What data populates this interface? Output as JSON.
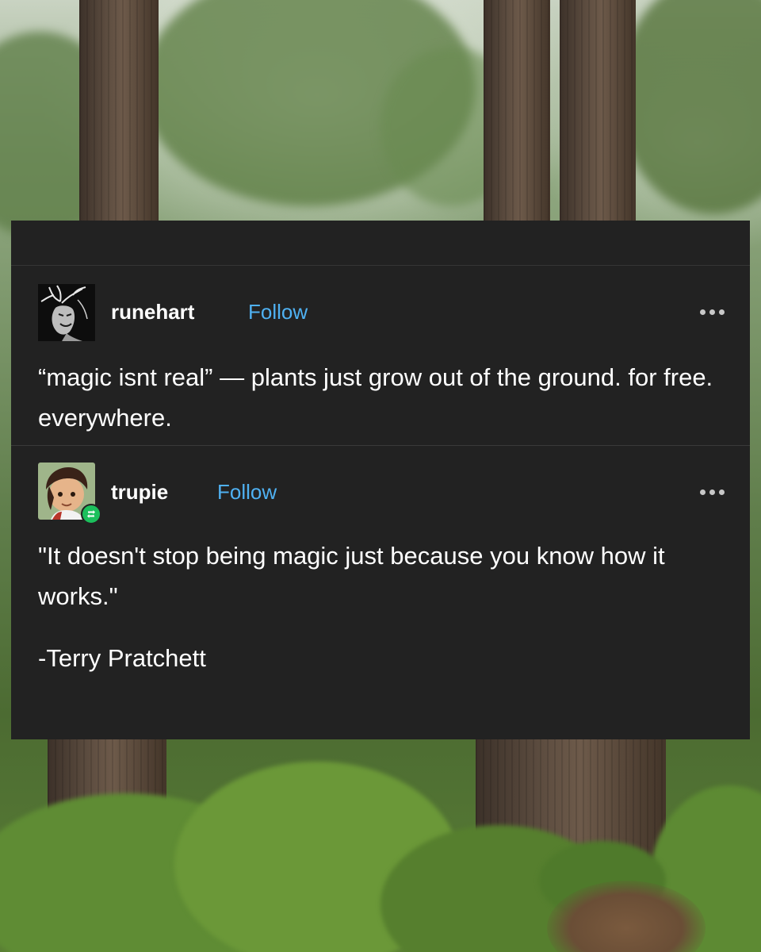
{
  "posts": [
    {
      "username": "runehart",
      "follow_label": "Follow",
      "text": "“magic isnt real” — plants just grow out of the ground. for free. everywhere."
    },
    {
      "username": "trupie",
      "follow_label": "Follow",
      "text": "\"It doesn't stop being magic just because you know how it works.\"",
      "attribution": "-Terry Pratchett"
    }
  ],
  "icons": {
    "more": "ellipsis-icon",
    "reblog": "reblog-icon"
  },
  "colors": {
    "card_background": "#222222",
    "text": "#ffffff",
    "follow_link": "#4fb1f2",
    "reblog_badge": "#1bc05c"
  }
}
